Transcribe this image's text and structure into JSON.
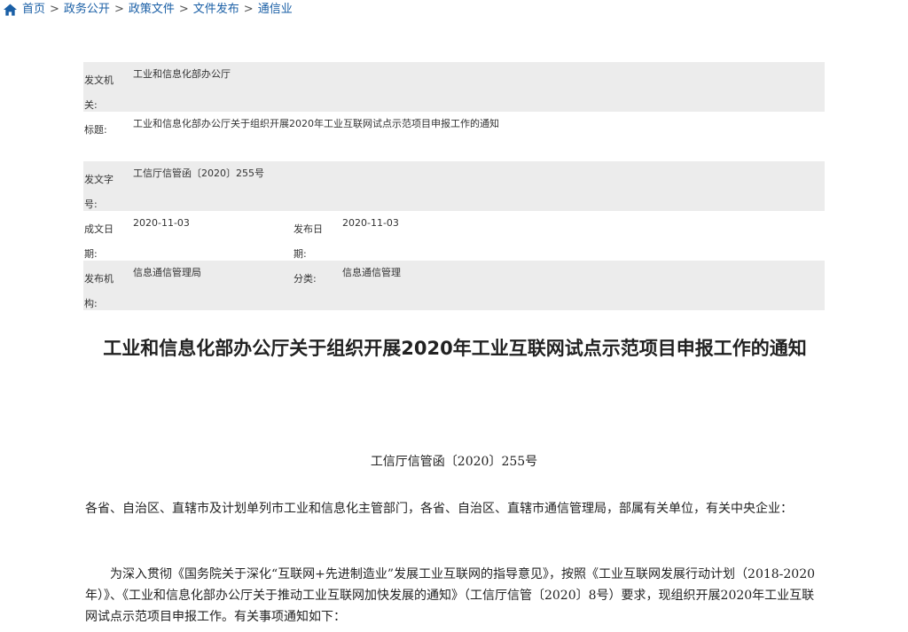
{
  "breadcrumb": {
    "items": [
      "首页",
      "政务公开",
      "政策文件",
      "文件发布",
      "通信业"
    ],
    "separator": ">"
  },
  "meta": {
    "issuer_label": "发文机关:",
    "issuer_value": "工业和信息化部办公厅",
    "title_label": "标题:",
    "title_value": "工业和信息化部办公厅关于组织开展2020年工业互联网试点示范项目申报工作的通知",
    "docno_label": "发文字号:",
    "docno_value": "工信厅信管函〔2020〕255号",
    "date_label": "成文日期:",
    "date_value": "2020-11-03",
    "pubdate_label": "发布日期:",
    "pubdate_value": "2020-11-03",
    "agency_label": "发布机构:",
    "agency_value": "信息通信管理局",
    "category_label": "分类:",
    "category_value": "信息通信管理"
  },
  "document": {
    "title": "工业和信息化部办公厅关于组织开展2020年工业互联网试点示范项目申报工作的通知",
    "number": "工信厅信管函〔2020〕255号",
    "address": "各省、自治区、直辖市及计划单列市工业和信息化主管部门，各省、自治区、直辖市通信管理局，部属有关单位，有关中央企业：",
    "body": "为深入贯彻《国务院关于深化“互联网+先进制造业”发展工业互联网的指导意见》，按照《工业互联网发展行动计划（2018-2020年）》、《工业和信息化部办公厅关于推动工业互联网加快发展的通知》（工信厅信管〔2020〕8号）要求，现组织开展2020年工业互联网试点示范项目申报工作。有关事项通知如下："
  },
  "colors": {
    "link": "#1a5fa6",
    "row_shade": "#ececec"
  }
}
